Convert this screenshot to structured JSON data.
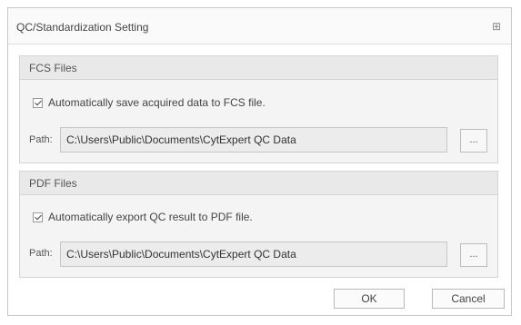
{
  "dialog": {
    "title": "QC/Standardization Setting",
    "close_glyph": "⊞"
  },
  "fcs": {
    "header": "FCS Files",
    "checkbox_label": "Automatically save acquired data to FCS file.",
    "checked": true,
    "path_label": "Path:",
    "path_value": "C:\\Users\\Public\\Documents\\CytExpert QC Data",
    "browse_label": "..."
  },
  "pdf": {
    "header": "PDF Files",
    "checkbox_label": "Automatically export QC result to PDF file.",
    "checked": true,
    "path_label": "Path:",
    "path_value": "C:\\Users\\Public\\Documents\\CytExpert QC Data",
    "browse_label": "..."
  },
  "buttons": {
    "ok_label": "OK",
    "cancel_label": "Cancel"
  }
}
